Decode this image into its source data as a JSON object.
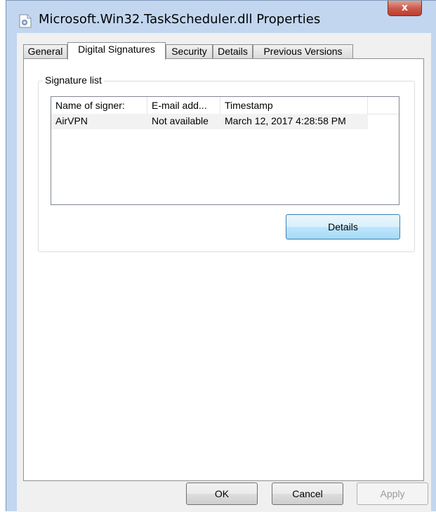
{
  "window": {
    "title": "Microsoft.Win32.TaskScheduler.dll Properties",
    "close_label": "x"
  },
  "tabs": [
    {
      "label": "General",
      "active": false
    },
    {
      "label": "Digital Signatures",
      "active": true
    },
    {
      "label": "Security",
      "active": false
    },
    {
      "label": "Details",
      "active": false
    },
    {
      "label": "Previous Versions",
      "active": false
    }
  ],
  "signatures": {
    "group_label": "Signature list",
    "columns": [
      "Name of signer:",
      "E-mail add...",
      "Timestamp"
    ],
    "rows": [
      [
        "AirVPN",
        "Not available",
        "March 12, 2017 4:28:58 PM"
      ]
    ],
    "details_label": "Details"
  },
  "footer": {
    "ok_label": "OK",
    "cancel_label": "Cancel",
    "apply_label": "Apply"
  }
}
